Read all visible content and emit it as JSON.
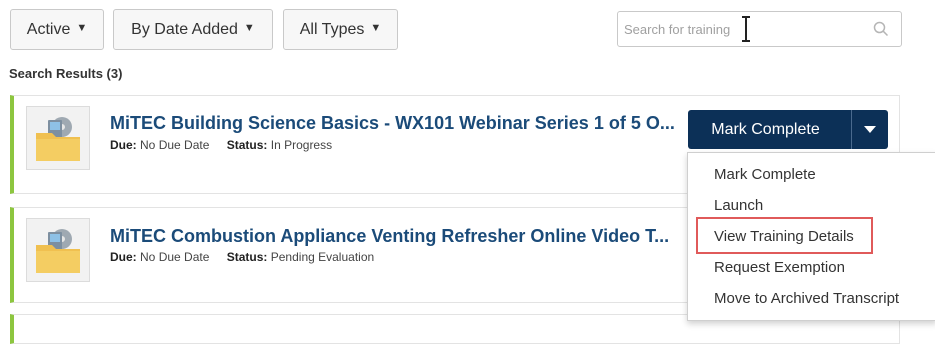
{
  "filters": {
    "status": "Active",
    "sort": "By Date Added",
    "type": "All Types"
  },
  "search": {
    "placeholder": "Search for training",
    "value": ""
  },
  "results_label": "Search Results (3)",
  "results": [
    {
      "title": "MiTEC Building Science Basics - WX101 Webinar Series 1 of 5 O...",
      "due_label": "Due:",
      "due": "No Due Date",
      "status_label": "Status:",
      "status": "In Progress"
    },
    {
      "title": "MiTEC Combustion Appliance Venting Refresher Online Video T...",
      "due_label": "Due:",
      "due": "No Due Date",
      "status_label": "Status:",
      "status": "Pending Evaluation"
    }
  ],
  "action_button": {
    "label": "Mark Complete"
  },
  "menu": {
    "items": [
      "Mark Complete",
      "Launch",
      "View Training Details",
      "Request Exemption",
      "Move to Archived Transcript"
    ],
    "highlighted_index": 2
  },
  "colors": {
    "title_blue": "#1b4b79",
    "button_navy": "#0c3057",
    "card_accent_green": "#8dc63f",
    "highlight_red": "#e05a5a"
  },
  "icons": {
    "filter_caret": "caret-down-icon",
    "search": "search-icon",
    "thumbnail": "folder-media-icon"
  }
}
